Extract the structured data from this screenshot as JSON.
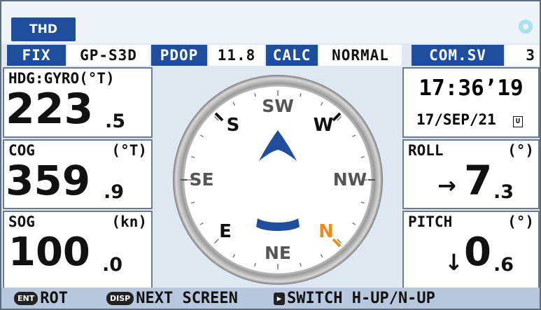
{
  "header": {
    "mode_label": "THD"
  },
  "status": {
    "fix_label": "FIX",
    "fix_value": "GP-S3D",
    "pdop_label": "PDOP",
    "pdop_value": "11.8",
    "calc_label": "CALC",
    "calc_value": "NORMAL",
    "com_label": "COM.SV",
    "com_value": "3"
  },
  "heading": {
    "label": "HDG:GYRO(°T)",
    "int": "223",
    "dec": ".5"
  },
  "cog": {
    "label": "COG",
    "unit": "(°T)",
    "int": "359",
    "dec": ".9"
  },
  "sog": {
    "label": "SOG",
    "unit": "(kn)",
    "int": "100",
    "dec": ".0"
  },
  "clock": {
    "time": "17:36’19",
    "date": "17/SEP/21",
    "tz_badge": "U"
  },
  "roll": {
    "label": "ROLL",
    "unit": "(°)",
    "arrow": "→",
    "int": "7",
    "dec": ".3"
  },
  "pitch": {
    "label": "PITCH",
    "unit": "(°)",
    "arrow": "↓",
    "int": "0",
    "dec": ".6"
  },
  "compass": {
    "cardinals": {
      "sw": "SW",
      "s": "S",
      "w": "W",
      "se": "SE",
      "nw": "NW",
      "e": "E",
      "n": "N",
      "ne": "NE"
    },
    "north_color": "#f08a1c",
    "ship_color": "#1f4f9c"
  },
  "footer": {
    "ent_key": "ENT",
    "ent_label": "ROT",
    "disp_key": "DISP",
    "disp_label": "NEXT SCREEN",
    "switch_key": "▶",
    "switch_label": "SWITCH H-UP/N-UP"
  },
  "colors": {
    "accent": "#1f4f9c",
    "background": "#dfe7f1",
    "footer": "#b7c7dd",
    "north": "#f08a1c"
  }
}
